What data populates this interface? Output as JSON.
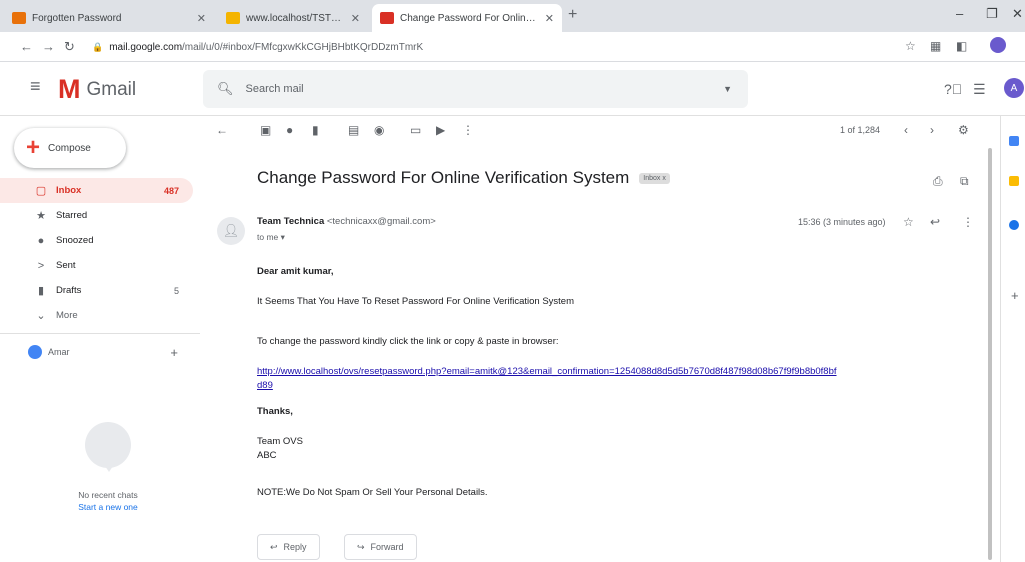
{
  "browser": {
    "tabs": [
      {
        "title": "Forgotten Password",
        "favicon_color": "#e8710a"
      },
      {
        "title": "www.localhost/TSTEMP/ChUe",
        "favicon_color": "#f4b400"
      },
      {
        "title": "Change Password For Online Ve",
        "favicon_color": "#d93025"
      }
    ],
    "new_tab": "+",
    "url_host": "mail.google.com",
    "url_path": "/mail/u/0/#inbox/FMfcgxwKkCGHjBHbtKQrDDzmTmrK",
    "window_controls": {
      "minimize": "–",
      "restore": "❐",
      "close": "✕"
    }
  },
  "gmail": {
    "product_name": "Gmail",
    "search_placeholder": "Search mail",
    "avatar_letter": "A"
  },
  "sidebar": {
    "compose_label": "Compose",
    "nav": [
      {
        "label": "Inbox",
        "count": "487",
        "icon": "inbox-icon",
        "active": true
      },
      {
        "label": "Starred",
        "count": "",
        "icon": "star-icon",
        "active": false
      },
      {
        "label": "Snoozed",
        "count": "",
        "icon": "clock-icon",
        "active": false
      },
      {
        "label": "Sent",
        "count": "",
        "icon": "send-icon",
        "active": false
      },
      {
        "label": "Drafts",
        "count": "5",
        "icon": "draft-icon",
        "active": false
      },
      {
        "label": "More",
        "count": "",
        "icon": "chevron-down-icon",
        "active": false
      }
    ],
    "hangouts_user": "Amar",
    "hangouts_empty": "No recent chats",
    "hangouts_start": "Start a new one"
  },
  "toolbar": {
    "page_count": "1 of 1,284"
  },
  "email": {
    "subject": "Change Password For Online Verification System",
    "label_chip": "Inbox x",
    "sender_name": "Team Technica",
    "sender_email": "<technicaxx@gmail.com>",
    "to": "to me",
    "time": "15:36 (3 minutes ago)",
    "greeting": "Dear amit kumar,",
    "line1": "It Seems That You Have To Reset Password For Online Verification System",
    "line2": "To change the password kindly click the link or copy & paste in browser:",
    "link": "http://www.localhost/ovs/resetpassword.php?email=amitk@123&email_confirmation=1254088d8d5d5b7670d8f487f98d08b67f9f9b8b0f8bfd89",
    "thanks": "Thanks,",
    "signoff1": "Team OVS",
    "signoff2": "ABC",
    "note": "NOTE:We Do Not Spam Or Sell Your Personal Details.",
    "reply_label": "Reply",
    "forward_label": "Forward"
  }
}
